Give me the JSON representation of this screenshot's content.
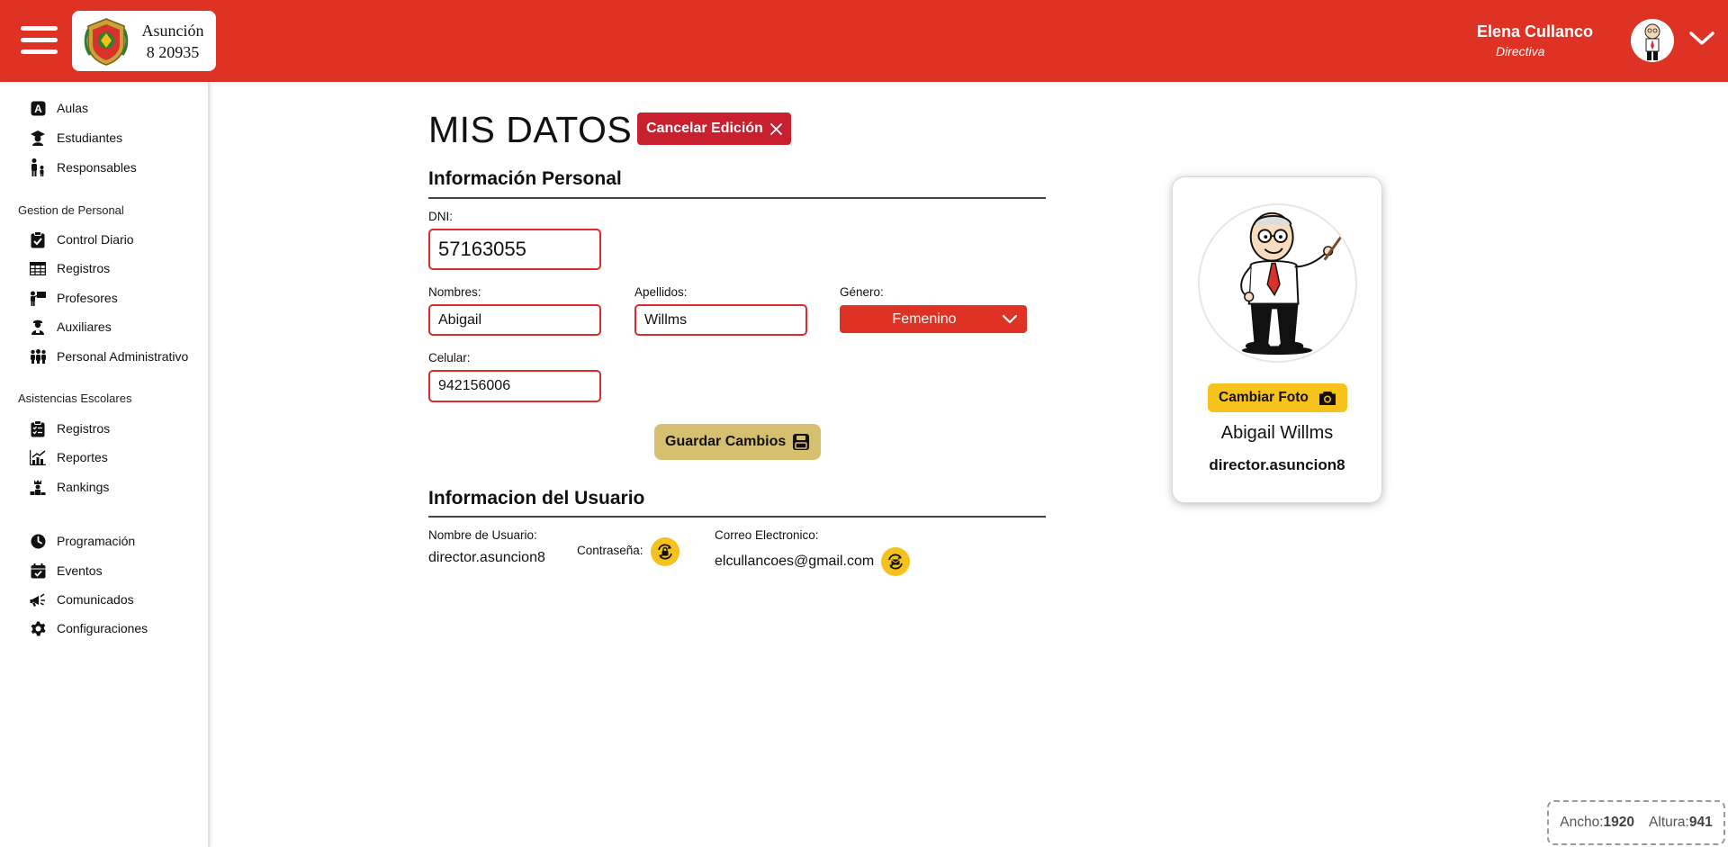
{
  "header": {
    "school_line1": "Asunción",
    "school_line2": "8 20935",
    "user_name": "Elena Cullanco",
    "user_role": "Directiva"
  },
  "sidebar": {
    "items_top": [
      "Aulas",
      "Estudiantes",
      "Responsables"
    ],
    "section_personal": "Gestion de Personal",
    "items_personal": [
      "Control Diario",
      "Registros",
      "Profesores",
      "Auxiliares",
      "Personal Administrativo"
    ],
    "section_asistencias": "Asistencias Escolares",
    "items_asistencias": [
      "Registros",
      "Reportes",
      "Rankings"
    ],
    "items_bottom": [
      "Programación",
      "Eventos",
      "Comunicados",
      "Configuraciones"
    ]
  },
  "main": {
    "title": "MIS DATOS",
    "cancel_label": "Cancelar Edición",
    "personal_section": "Información Personal",
    "dni_label": "DNI:",
    "dni_value": "57163055",
    "nombres_label": "Nombres:",
    "nombres_value": "Abigail",
    "apellidos_label": "Apellidos:",
    "apellidos_value": "Willms",
    "genero_label": "Género:",
    "genero_value": "Femenino",
    "celular_label": "Celular:",
    "celular_value": "942156006",
    "save_label": "Guardar Cambios",
    "user_section": "Informacion del Usuario",
    "username_label": "Nombre de Usuario:",
    "username_value": "director.asuncion8",
    "password_label": "Contraseña:",
    "email_label": "Correo Electronico:",
    "email_value": "elcullancoes@gmail.com"
  },
  "profile": {
    "change_photo_label": "Cambiar Foto",
    "name": "Abigail Willms",
    "username": "director.asuncion8"
  },
  "dimensions": {
    "width_label": "Ancho:",
    "width_value": "1920",
    "height_label": "Altura:",
    "height_value": "941"
  },
  "colors": {
    "header_red": "#dd3224",
    "cancel_red": "#c8202e",
    "save_gold": "#d6bf6f",
    "accent_yellow": "#f8c21c"
  }
}
